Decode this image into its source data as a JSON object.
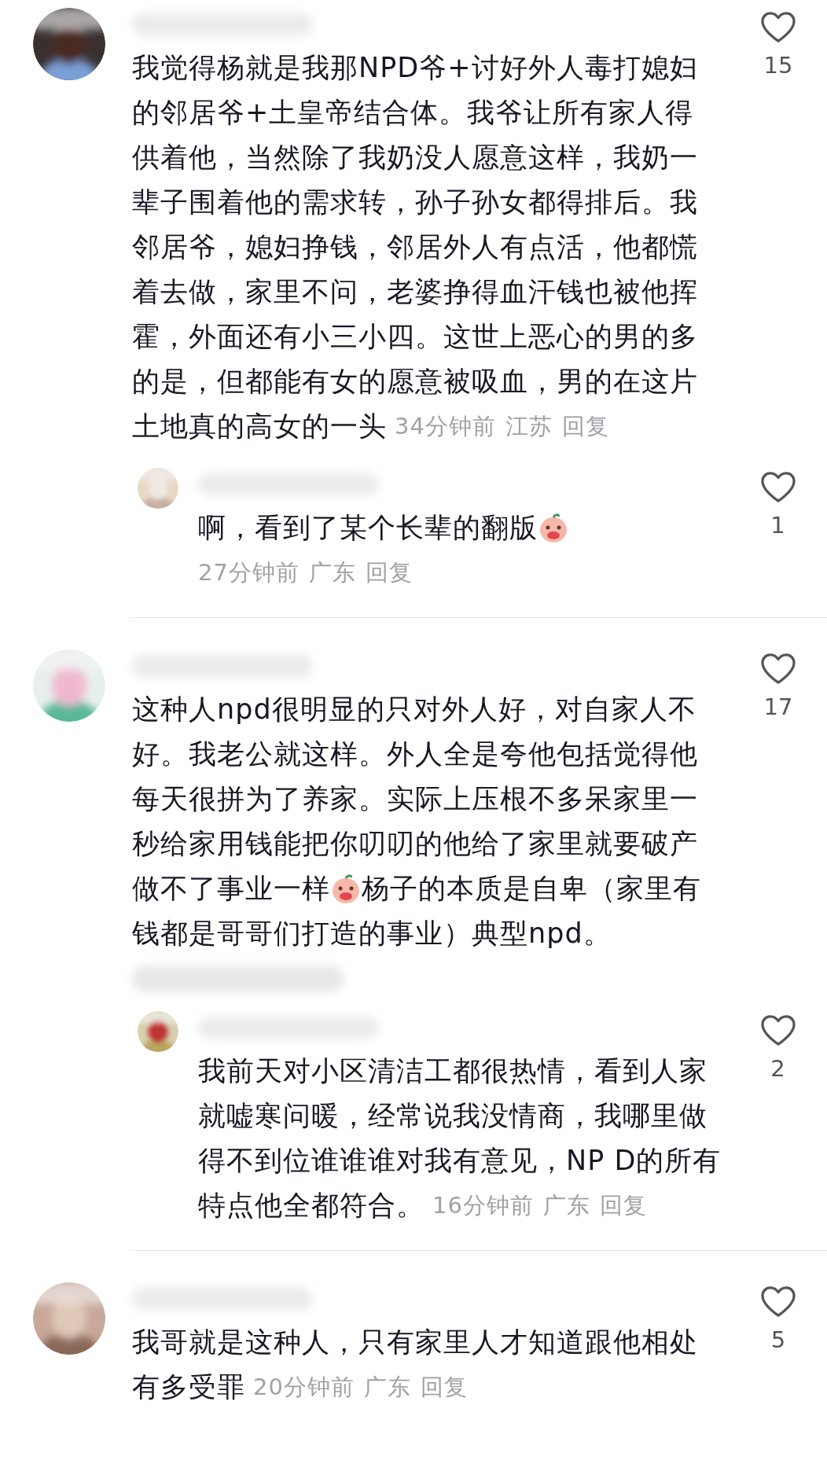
{
  "comments": [
    {
      "lines": [
        [
          {
            "kind": "text",
            "text": "我觉得杨就是我那NPD爷+讨好外人毒打媳妇"
          }
        ],
        [
          {
            "kind": "text",
            "text": "的邻居爷+土皇帝结合体。我爷让所有家人得"
          }
        ],
        [
          {
            "kind": "text",
            "text": "供着他，当然除了我奶没人愿意这样，我奶一"
          }
        ],
        [
          {
            "kind": "text",
            "text": "辈子围着他的需求转，孙子孙女都得排后。我"
          }
        ],
        [
          {
            "kind": "text",
            "text": "邻居爷，媳妇挣钱，邻居外人有点活，他都慌"
          }
        ],
        [
          {
            "kind": "text",
            "text": "着去做，家里不问，老婆挣得血汗钱也被他挥"
          }
        ],
        [
          {
            "kind": "text",
            "text": "霍，外面还有小三小四。这世上恶心的男的多"
          }
        ],
        [
          {
            "kind": "text",
            "text": "的是，但都能有女的愿意被吸血，男的在这片"
          }
        ],
        [
          {
            "kind": "text",
            "text": "土地真的高女的一头"
          }
        ]
      ],
      "time": "34分钟前",
      "region": "江苏",
      "reply": "回复",
      "likes": "15",
      "replies": [
        {
          "lines": [
            [
              {
                "kind": "text",
                "text": "啊，看到了某个长辈的翻版"
              },
              {
                "kind": "sticker"
              }
            ]
          ],
          "time": "27分钟前",
          "region": "广东",
          "reply": "回复",
          "likes": "1"
        }
      ]
    },
    {
      "lines": [
        [
          {
            "kind": "text",
            "text": "这种人npd很明显的只对外人好，对自家人不"
          }
        ],
        [
          {
            "kind": "text",
            "text": "好。我老公就这样。外人全是夸他包括觉得他"
          }
        ],
        [
          {
            "kind": "text",
            "text": "每天很拼为了养家。实际上压根不多呆家里一"
          }
        ],
        [
          {
            "kind": "text",
            "text": "秒给家用钱能把你叨叨的他给了家里就要破产"
          }
        ],
        [
          {
            "kind": "text",
            "text": "做不了事业一样"
          },
          {
            "kind": "sticker"
          },
          {
            "kind": "text",
            "text": "杨子的本质是自卑（家里有"
          }
        ],
        [
          {
            "kind": "text",
            "text": "钱都是哥哥们打造的事业）典型npd。"
          }
        ]
      ],
      "likes": "17",
      "replies": [
        {
          "lines": [
            [
              {
                "kind": "text",
                "text": "我前天对小区清洁工都很热情，看到人家"
              }
            ],
            [
              {
                "kind": "text",
                "text": "就嘘寒问暖，经常说我没情商，我哪里做"
              }
            ],
            [
              {
                "kind": "text",
                "text": "得不到位谁谁谁对我有意见，NP D的所有"
              }
            ],
            [
              {
                "kind": "text",
                "text": "特点他全都符合。"
              }
            ]
          ],
          "time": "16分钟前",
          "region": "广东",
          "reply": "回复",
          "likes": "2"
        }
      ]
    },
    {
      "lines": [
        [
          {
            "kind": "text",
            "text": "我哥就是这种人，只有家里人才知道跟他相处"
          }
        ],
        [
          {
            "kind": "text",
            "text": "有多受罪"
          }
        ]
      ],
      "time": "20分钟前",
      "region": "广东",
      "reply": "回复",
      "likes": "5"
    }
  ]
}
